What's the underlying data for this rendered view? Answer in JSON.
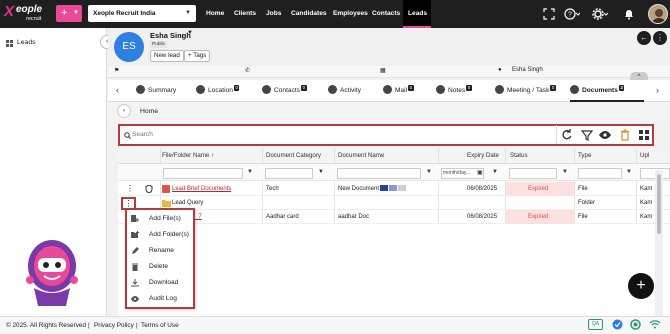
{
  "app": {
    "brand": "eople",
    "brand_x": "X",
    "brand_sub": "recruit",
    "add_symbol": "+",
    "company": "Xeople Recruit India"
  },
  "nav": {
    "items": [
      "Home",
      "Clients",
      "Jobs",
      "Candidates",
      "Employees",
      "Contacts",
      "Leads"
    ],
    "active": "Leads"
  },
  "sidebar": {
    "leads_label": "Leads"
  },
  "record": {
    "initials": "ES",
    "name": "Esha Singh",
    "visibility": "Public",
    "new_lead_label": "New lead",
    "tags_label": "+ Tags",
    "owner": "Esha Singh"
  },
  "tabs": [
    {
      "label": "Summary",
      "count": ""
    },
    {
      "label": "Location",
      "count": "0"
    },
    {
      "label": "Contacts",
      "count": "0"
    },
    {
      "label": "Activity",
      "count": ""
    },
    {
      "label": "Mail",
      "count": "0"
    },
    {
      "label": "Notes",
      "count": "0"
    },
    {
      "label": "Meeting / Task",
      "count": "0"
    },
    {
      "label": "Documents",
      "count": "3"
    }
  ],
  "breadcrumb": {
    "home": "Home"
  },
  "search": {
    "placeholder": "Search"
  },
  "table": {
    "headers": {
      "name": "File/Folder Name",
      "category": "Document Category",
      "docname": "Document Name",
      "expiry": "Expiry Date",
      "status": "Status",
      "type": "Type",
      "upload": "Upl"
    },
    "expiry_filter_placeholder": "month/day...",
    "rows": [
      {
        "name": "Lead Brief Documents",
        "category": "Tech",
        "docname": "New Document",
        "expiry": "06/08/2025",
        "status": "Expired",
        "type": "File",
        "upload": "Kam"
      },
      {
        "name": "Lead Query",
        "category": "",
        "docname": "",
        "expiry": "",
        "status": "",
        "type": "Folder",
        "upload": "Kam"
      },
      {
        "name": "ot_7",
        "category": "Aadhar card",
        "docname": "aadhar Doc",
        "expiry": "06/08/2025",
        "status": "Expired",
        "type": "File",
        "upload": "Kam"
      }
    ]
  },
  "context_menu": {
    "items": [
      "Add File(s)",
      "Add Folder(s)",
      "Rename",
      "Delete",
      "Download",
      "Audit Log"
    ]
  },
  "fab": {
    "symbol": "+"
  },
  "footer": {
    "copyright": "© 2025. All Rights Reserved",
    "privacy": "Privacy Policy",
    "terms": "Terms of Use",
    "qa": "QA"
  },
  "colors": {
    "accent": "#e94a98",
    "highlight_border": "#b73a3a",
    "expired_bg": "#fde0e0",
    "avatar": "#2e7fe0"
  }
}
